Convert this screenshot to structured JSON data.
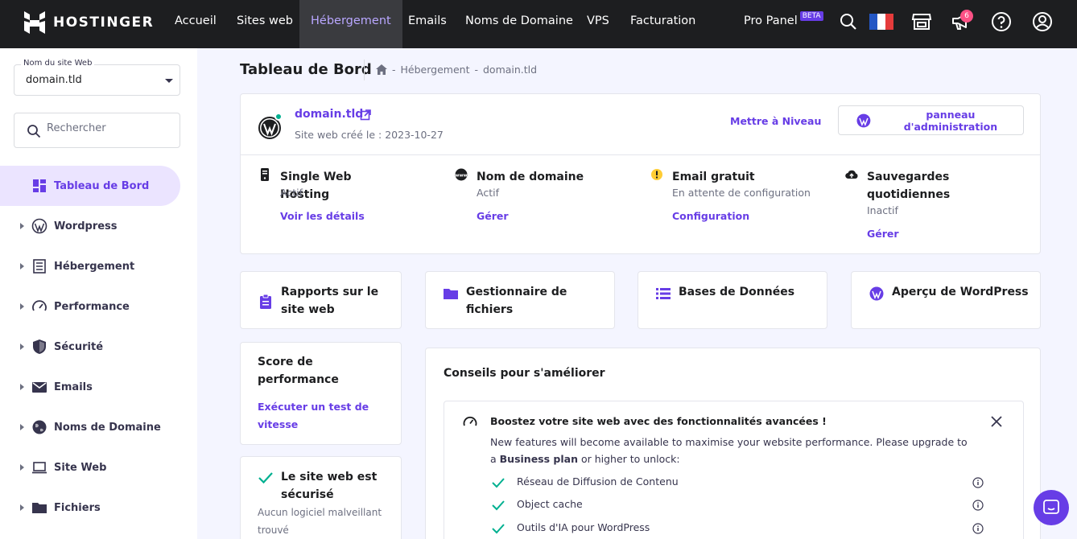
{
  "brand": {
    "name": "HOSTINGER",
    "accent": "#673de6"
  },
  "nav": {
    "items": [
      {
        "label": "Accueil"
      },
      {
        "label": "Sites web"
      },
      {
        "label": "Hébergement",
        "active": true
      },
      {
        "label": "Emails"
      },
      {
        "label": "Noms de Domaine"
      },
      {
        "label": "VPS"
      },
      {
        "label": "Facturation"
      }
    ],
    "pro_panel": "Pro Panel",
    "beta": "BETA",
    "notifications_count": "6",
    "icons": [
      "search-icon",
      "flag-fr-icon",
      "store-icon",
      "megaphone-icon",
      "help-icon",
      "account-icon"
    ]
  },
  "sidebar": {
    "site_select": {
      "label": "Nom du site Web",
      "value": "domain.tld"
    },
    "search": {
      "placeholder": "Rechercher"
    },
    "items": [
      {
        "label": "Tableau de Bord",
        "icon": "dashboard-icon",
        "active": true
      },
      {
        "label": "Wordpress",
        "icon": "wordpress-icon"
      },
      {
        "label": "Hébergement",
        "icon": "server-icon"
      },
      {
        "label": "Performance",
        "icon": "gauge-icon"
      },
      {
        "label": "Sécurité",
        "icon": "shield-icon"
      },
      {
        "label": "Emails",
        "icon": "mail-icon"
      },
      {
        "label": "Noms de Domaine",
        "icon": "globe-icon"
      },
      {
        "label": "Site Web",
        "icon": "laptop-icon"
      },
      {
        "label": "Fichiers",
        "icon": "folder-icon"
      }
    ]
  },
  "page": {
    "title": "Tableau de Bord",
    "breadcrumb": [
      "Hébergement",
      "domain.tld"
    ],
    "breadcrumb_sep": "-"
  },
  "summary": {
    "domain": "domain.tld",
    "created": "Site web créé le : 2023-10-27",
    "upgrade": "Mettre à Niveau",
    "admin": "panneau d'administration",
    "services": [
      {
        "title": "Single Web Hosting",
        "status": "Actif",
        "link": "Voir les détails",
        "icon": "phone-server-icon"
      },
      {
        "title": "Nom de domaine",
        "status": "Actif",
        "link": "Gérer",
        "icon": "www-icon"
      },
      {
        "title": "Email gratuit",
        "status": "En attente de configuration",
        "link": "Configuration",
        "icon": "warning-icon"
      },
      {
        "title": "Sauvegardes quotidiennes",
        "status": "Inactif",
        "link": "Gérer",
        "icon": "cloud-upload-icon"
      }
    ]
  },
  "tiles": [
    {
      "label": "Rapports sur le site web",
      "icon": "report-icon"
    },
    {
      "label": "Gestionnaire de fichiers",
      "icon": "folder-icon"
    },
    {
      "label": "Bases de Données",
      "icon": "database-icon"
    },
    {
      "label": "Aperçu de WordPress",
      "icon": "wordpress-icon"
    }
  ],
  "score": {
    "title": "Score de performance",
    "link": "Exécuter un test de vitesse"
  },
  "secure": {
    "title": "Le site web est sécurisé",
    "text": "Aucun logiciel malveillant trouvé"
  },
  "tips": {
    "title": "Conseils pour s'améliorer",
    "head": "Boostez votre site web avec des fonctionnalités avancées !",
    "desc_pre": "New features will become available to maximise your website performance. Please upgrade to a ",
    "desc_bold": "Business plan",
    "desc_post": " or higher to unlock:",
    "features": [
      "Réseau de Diffusion de Contenu",
      "Object cache",
      "Outils d'IA pour WordPress"
    ]
  },
  "colors": {
    "topbar": "#1d1e20",
    "active_bg": "#ebe4ff",
    "success": "#00b090",
    "warning": "#ffcd35"
  }
}
